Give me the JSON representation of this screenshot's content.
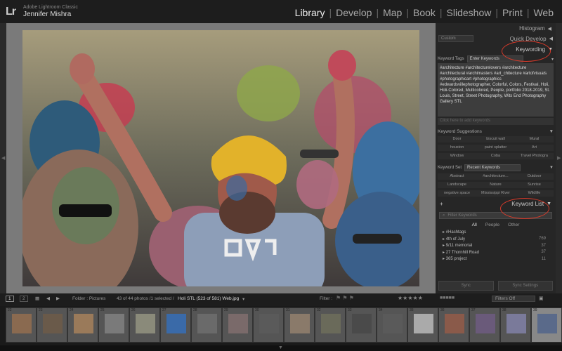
{
  "app": {
    "logo": "Lr",
    "product": "Adobe Lightroom Classic",
    "user": "Jennifer Mishra"
  },
  "modules": [
    {
      "label": "Library",
      "active": true
    },
    {
      "label": "Develop",
      "active": false
    },
    {
      "label": "Map",
      "active": false
    },
    {
      "label": "Book",
      "active": false
    },
    {
      "label": "Slideshow",
      "active": false
    },
    {
      "label": "Print",
      "active": false
    },
    {
      "label": "Web",
      "active": false
    }
  ],
  "right_panel": {
    "histogram": "Histogram",
    "quick_develop": "Quick Develop",
    "quick_develop_preset": "Custom",
    "keywording": "Keywording",
    "keyword_tags_label": "Keyword Tags",
    "keyword_tags_mode": "Enter Keywords",
    "keywords_text": "#architecture #architecturelovers #architecture #architectural #archimasters #art_chitecture #artofvisuals #photographicart #photographics #edwardsvillephotographer, Colorful, Colors, Festival, Holi, Holi-Colored, Multicolored, People, portfolio 2018-2019, St. Louis, Street, Street Photography, Wits End Photography Gallery STL",
    "keyword_entry_placeholder": "Click here to add keywords",
    "suggestions_title": "Keyword Suggestions",
    "suggestions": [
      "Door",
      "biscuit wall",
      "Mural",
      "houston",
      "paint splatter",
      "Art",
      "Window",
      "Coba",
      "Travel Photogra"
    ],
    "keyword_set_label": "Keyword Set",
    "keyword_set_value": "Recent Keywords",
    "keyword_set": [
      "Abstract",
      "#architecture...",
      "Outdoor",
      "Landscape",
      "Nature",
      "Sunrise",
      "negative space",
      "Mississippi River",
      "Wildlife"
    ],
    "keyword_list": "Keyword List",
    "filter_placeholder": "Filter Keywords",
    "filters": [
      {
        "label": "All",
        "on": true
      },
      {
        "label": "People",
        "on": false
      },
      {
        "label": "Other",
        "on": false
      }
    ],
    "keyword_rows": [
      {
        "name": "#Hashtags",
        "count": ""
      },
      {
        "name": "4th of July",
        "count": "769"
      },
      {
        "name": "9/11 memorial",
        "count": "37"
      },
      {
        "name": "27 Thornhill Road",
        "count": "37"
      },
      {
        "name": "365 project",
        "count": "11"
      }
    ],
    "sync": "Sync",
    "sync_settings": "Sync Settings"
  },
  "toolbar": {
    "page1": "1",
    "page2": "2",
    "folder": "Folder : Pictures",
    "count": "43 of 44 photos /1 selected /",
    "filename": "Holi STL (523 of 581) Web.jpg",
    "filter_label": "Filter :",
    "filters_off": "Filters Off"
  },
  "filmstrip": {
    "numbers": [
      "22",
      "23",
      "24",
      "25",
      "26",
      "27",
      "28",
      "29",
      "30",
      "31",
      "32",
      "33",
      "34",
      "35",
      "36",
      "37",
      "38",
      "39"
    ]
  },
  "colors": {
    "accent": "#d63a2a",
    "panel": "#262626",
    "background": "#7a7a7a"
  }
}
